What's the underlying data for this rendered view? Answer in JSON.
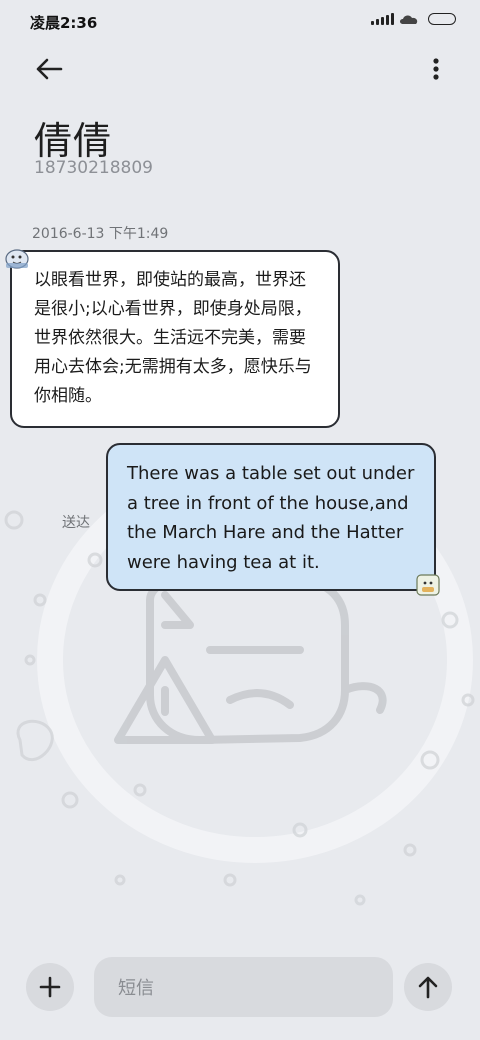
{
  "status_bar": {
    "time": "凌晨2:36",
    "signal_icon": "signal-icon",
    "notification_icon": "cloud-icon",
    "battery_icon": "battery-icon"
  },
  "header": {
    "back_icon": "back-arrow-icon",
    "more_icon": "more-vertical-icon",
    "contact_name": "倩倩",
    "contact_number": "18730218809"
  },
  "conversation": {
    "date": "2016-6-13 下午1:49",
    "messages": [
      {
        "direction": "incoming",
        "text": "以眼看世界，即使站的最高，世界还是很小;以心看世界，即使身处局限，世界依然很大。生活远不完美，需要用心去体会;无需拥有太多，愿快乐与你相随。"
      },
      {
        "direction": "outgoing",
        "text": "There was a table set out under a tree in front of the house,and the March Hare and the Hatter were having tea at it.",
        "status": "送达"
      }
    ]
  },
  "composer": {
    "add_icon": "plus-icon",
    "placeholder": "短信",
    "send_icon": "arrow-up-icon"
  },
  "colors": {
    "background": "#e8eaee",
    "incoming_bubble": "#ffffff",
    "outgoing_bubble": "#cfe4f7",
    "bubble_border": "#2a2d33",
    "control_fill": "#d8dade"
  }
}
